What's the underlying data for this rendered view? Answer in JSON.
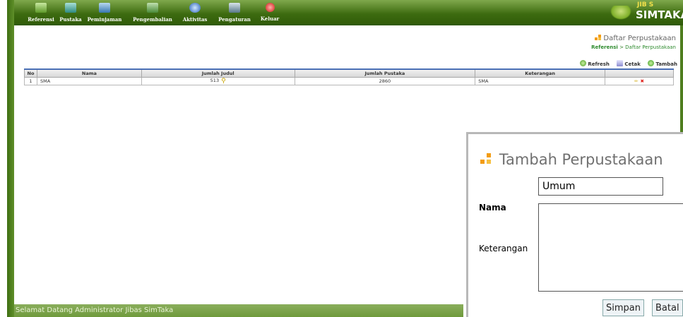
{
  "menu": {
    "items": [
      {
        "label": "Referensi",
        "icon": "list-icon",
        "color": "#8fc860"
      },
      {
        "label": "Pustaka",
        "icon": "books-icon",
        "color": "#5fb0a8"
      },
      {
        "label": "Peminjaman",
        "icon": "borrow-icon",
        "color": "#6aa8d8"
      },
      {
        "label": "Pengembalian",
        "icon": "return-icon",
        "color": "#78b868"
      },
      {
        "label": "Aktivitas",
        "icon": "globe-icon",
        "color": "#4a8ad8"
      },
      {
        "label": "Pengaturan",
        "icon": "wrench-icon",
        "color": "#7a9aa8"
      },
      {
        "label": "Keluar",
        "icon": "power-icon",
        "color": "#e83030"
      }
    ]
  },
  "logo": {
    "top": "JIB S",
    "main": "SIMTAKA"
  },
  "page": {
    "title": "Daftar Perpustakaan"
  },
  "breadcrumb": {
    "root": "Referensi",
    "separator": ">",
    "current": "Daftar Perpustakaan"
  },
  "actions": {
    "refresh": "Refresh",
    "print": "Cetak",
    "add": "Tambah"
  },
  "table": {
    "headers": {
      "no": "No",
      "nama": "Nama",
      "jumlah_judul": "Jumlah Judul",
      "jumlah_pustaka": "Jumlah Pustaka",
      "keterangan": "Keterangan"
    },
    "rows": [
      {
        "no": "1",
        "nama": "SMA",
        "jumlah_judul": "513",
        "jumlah_pustaka": "2860",
        "keterangan": "SMA"
      }
    ]
  },
  "status": {
    "text": "Selamat Datang Administrator Jibas SimTaka"
  },
  "dialog": {
    "title": "Tambah Perpustakaan",
    "nama_label": "Nama",
    "nama_value": "Umum",
    "keterangan_label": "Keterangan",
    "keterangan_value": "",
    "save_label": "Simpan",
    "cancel_label": "Batal"
  },
  "colors": {
    "brand_green": "#3d6b10",
    "accent_orange": "#f39c12",
    "link_green": "#2e8b2e",
    "table_header_border": "#4a6fb5"
  }
}
